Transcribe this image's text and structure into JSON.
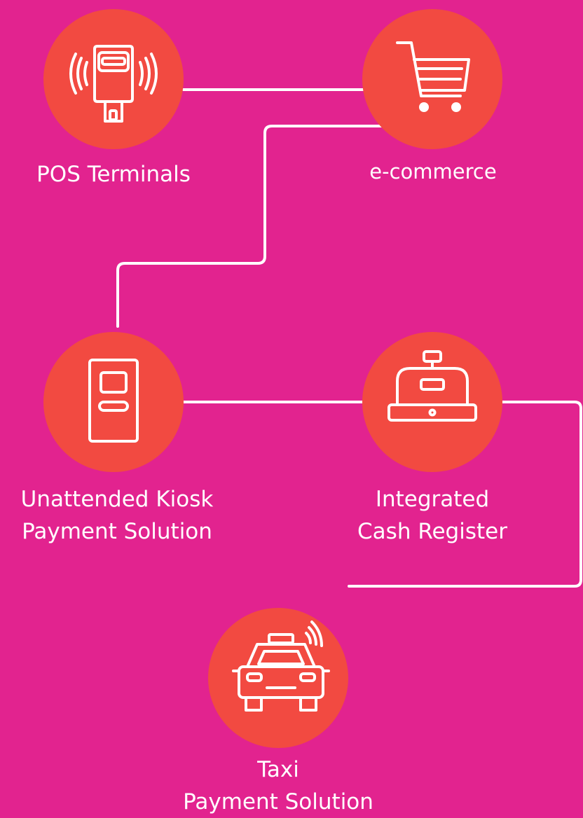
{
  "colors": {
    "background": "#e2238f",
    "node_fill": "#f24a41",
    "line": "#ffffff",
    "text": "#ffffff"
  },
  "nodes": [
    {
      "id": "pos",
      "icon": "pos-terminal-icon",
      "label_lines": [
        "POS Terminals"
      ]
    },
    {
      "id": "ecommerce",
      "icon": "shopping-cart-icon",
      "label_lines": [
        "e-commerce"
      ]
    },
    {
      "id": "kiosk",
      "icon": "kiosk-icon",
      "label_lines": [
        "Unattended Kiosk",
        "Payment Solution"
      ]
    },
    {
      "id": "register",
      "icon": "cash-register-icon",
      "label_lines": [
        "Integrated",
        "Cash Register"
      ]
    },
    {
      "id": "taxi",
      "icon": "taxi-icon",
      "label_lines": [
        "Taxi",
        "Payment Solution"
      ]
    }
  ]
}
